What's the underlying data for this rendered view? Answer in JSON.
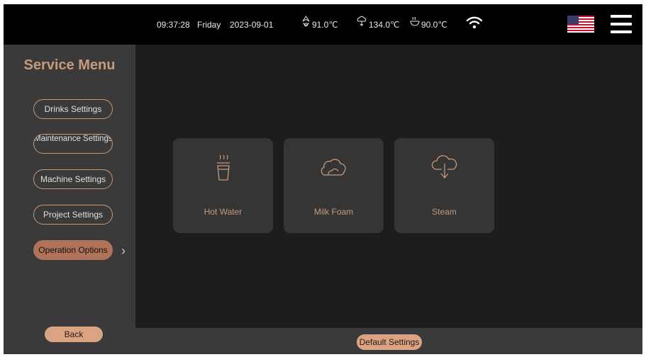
{
  "status_bar": {
    "time": "09:37:28",
    "day": "Friday",
    "date": "2023-09-01",
    "water_temp": "91.0℃",
    "steam_temp": "134.0℃",
    "coffee_temp": "90.0℃",
    "wifi_icon": "wifi-icon",
    "language_flag": "us-flag-icon",
    "menu_icon": "hamburger-menu-icon"
  },
  "sidebar": {
    "title": "Service Menu",
    "items": [
      {
        "label": "Drinks Settings",
        "active": false
      },
      {
        "label": "Maintenance Settings",
        "active": false
      },
      {
        "label": "Machine Settings",
        "active": false
      },
      {
        "label": "Project Settings",
        "active": false
      },
      {
        "label": "Operation Options",
        "active": true
      }
    ],
    "back_label": "Back"
  },
  "main": {
    "cards": [
      {
        "label": "Hot Water",
        "icon": "hot-water-cup-icon"
      },
      {
        "label": "Milk Foam",
        "icon": "milk-foam-icon"
      },
      {
        "label": "Steam",
        "icon": "steam-cloud-icon"
      }
    ]
  },
  "footer": {
    "default_settings_label": "Default Settings"
  },
  "colors": {
    "accent": "#c89a7c",
    "active": "#b07258",
    "button": "#d9a384",
    "background": "#1d1d1d",
    "panel": "#3a3a3a",
    "card": "#353535"
  }
}
